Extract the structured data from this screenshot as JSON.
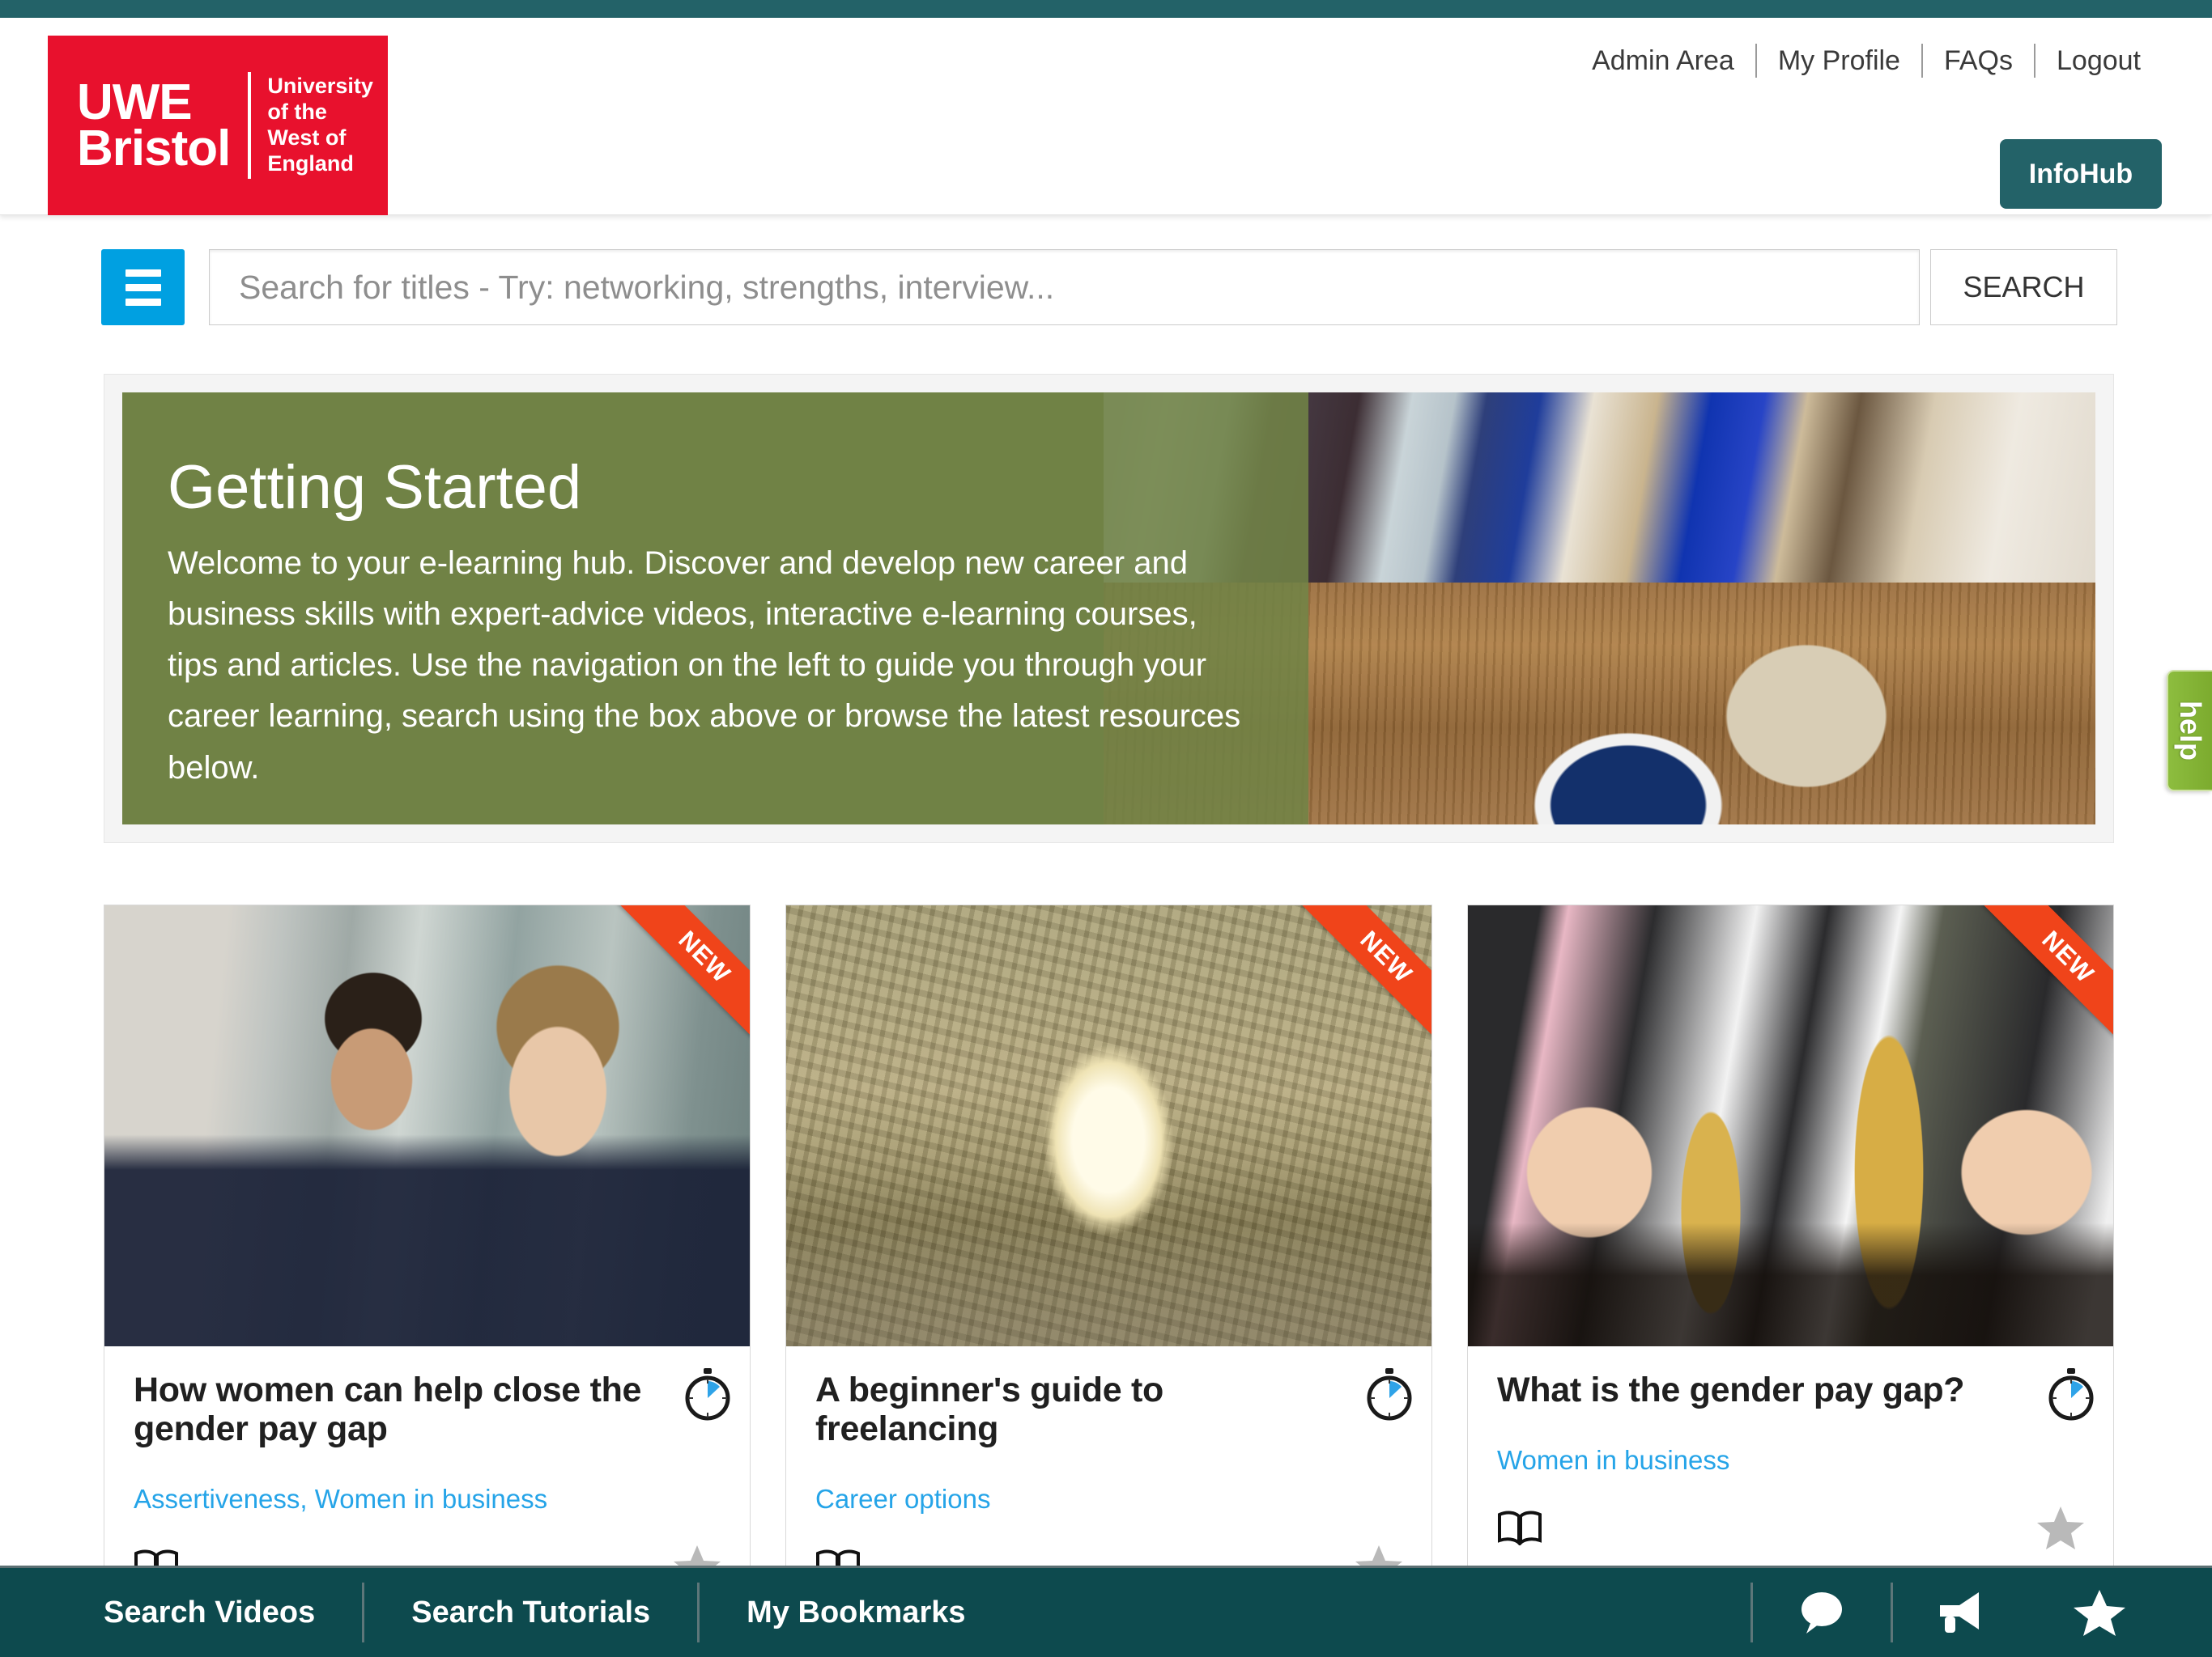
{
  "colors": {
    "teal_strip": "#236268",
    "brand_red": "#e8112d",
    "infohub_teal": "#236268",
    "burger_blue": "#00a0e1",
    "banner_green": "#718346",
    "tag_blue": "#25a4e8",
    "ribbon_orange": "#f0441a",
    "help_green": "#7cab2e",
    "footer_teal": "#0d4a4e"
  },
  "logo": {
    "line1": "UWE",
    "line2": "Bristol",
    "sub_line1": "University",
    "sub_line2": "of the",
    "sub_line3": "West of",
    "sub_line4": "England"
  },
  "topnav": {
    "items": [
      {
        "label": "Admin Area"
      },
      {
        "label": "My Profile"
      },
      {
        "label": "FAQs"
      },
      {
        "label": "Logout"
      }
    ],
    "infohub_label": "InfoHub"
  },
  "search": {
    "menu_icon": "hamburger-icon",
    "placeholder": "Search for titles - Try: networking, strengths, interview...",
    "value": "",
    "button_label": "SEARCH"
  },
  "banner": {
    "title": "Getting Started",
    "body": "Welcome to your e-learning hub. Discover and develop new career and business skills with expert-advice videos, interactive e-learning courses, tips and articles. Use the navigation on the left to guide you through your career learning, search using the box above or browse the latest resources below."
  },
  "cards": [
    {
      "badge": "NEW",
      "title": "How women can help close the gender pay gap",
      "tags": "Assertiveness, Women in business",
      "duration_icon": "stopwatch-icon",
      "type_icon": "book-icon",
      "bookmark_icon": "star-icon",
      "image_alt": "businessman-and-businesswoman-photo"
    },
    {
      "badge": "NEW",
      "title": "A beginner's guide to freelancing",
      "tags": "Career options",
      "duration_icon": "stopwatch-icon",
      "type_icon": "book-icon",
      "bookmark_icon": "star-icon",
      "image_alt": "stone-tunnel-bridge-photo"
    },
    {
      "badge": "NEW",
      "title": "What is the gender pay gap?",
      "tags": "Women in business",
      "duration_icon": "stopwatch-icon",
      "type_icon": "book-icon",
      "bookmark_icon": "star-icon",
      "image_alt": "coin-stacks-pay-gap-photo"
    }
  ],
  "help_tab": {
    "label": "help"
  },
  "footer": {
    "items": [
      {
        "label": "Search Videos"
      },
      {
        "label": "Search Tutorials"
      },
      {
        "label": "My Bookmarks"
      }
    ],
    "icons": [
      {
        "name": "chat-icon"
      },
      {
        "name": "megaphone-icon"
      },
      {
        "name": "star-icon"
      }
    ]
  }
}
